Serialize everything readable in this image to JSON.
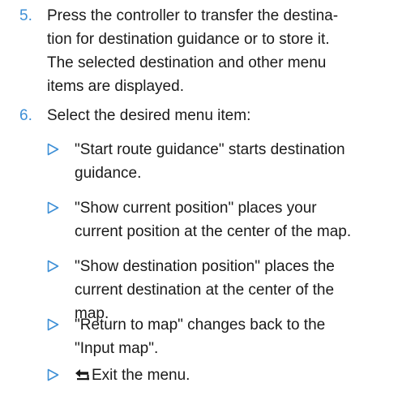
{
  "steps": [
    {
      "number": "5.",
      "lines": [
        "Press the controller to transfer the destina-",
        "tion for destination guidance or to store it.",
        "The selected destination and other menu",
        "items are displayed."
      ]
    },
    {
      "number": "6.",
      "lines": [
        "Select the desired menu item:"
      ]
    }
  ],
  "bullets": [
    {
      "lines": [
        "\"Start route guidance\" starts destination",
        "guidance."
      ]
    },
    {
      "lines": [
        "\"Show current position\" places your",
        "current position at the center of the map."
      ]
    },
    {
      "lines": [
        "\"Show destination position\" places the",
        "current destination at the center of the",
        "map."
      ]
    },
    {
      "lines": [
        "\"Return to map\" changes back to the",
        "\"Input map\"."
      ]
    },
    {
      "icon": "back-arrow-icon",
      "lines": [
        "Exit the menu."
      ]
    }
  ],
  "colors": {
    "accent": "#3d8fd6",
    "text": "#1a1a1a"
  }
}
